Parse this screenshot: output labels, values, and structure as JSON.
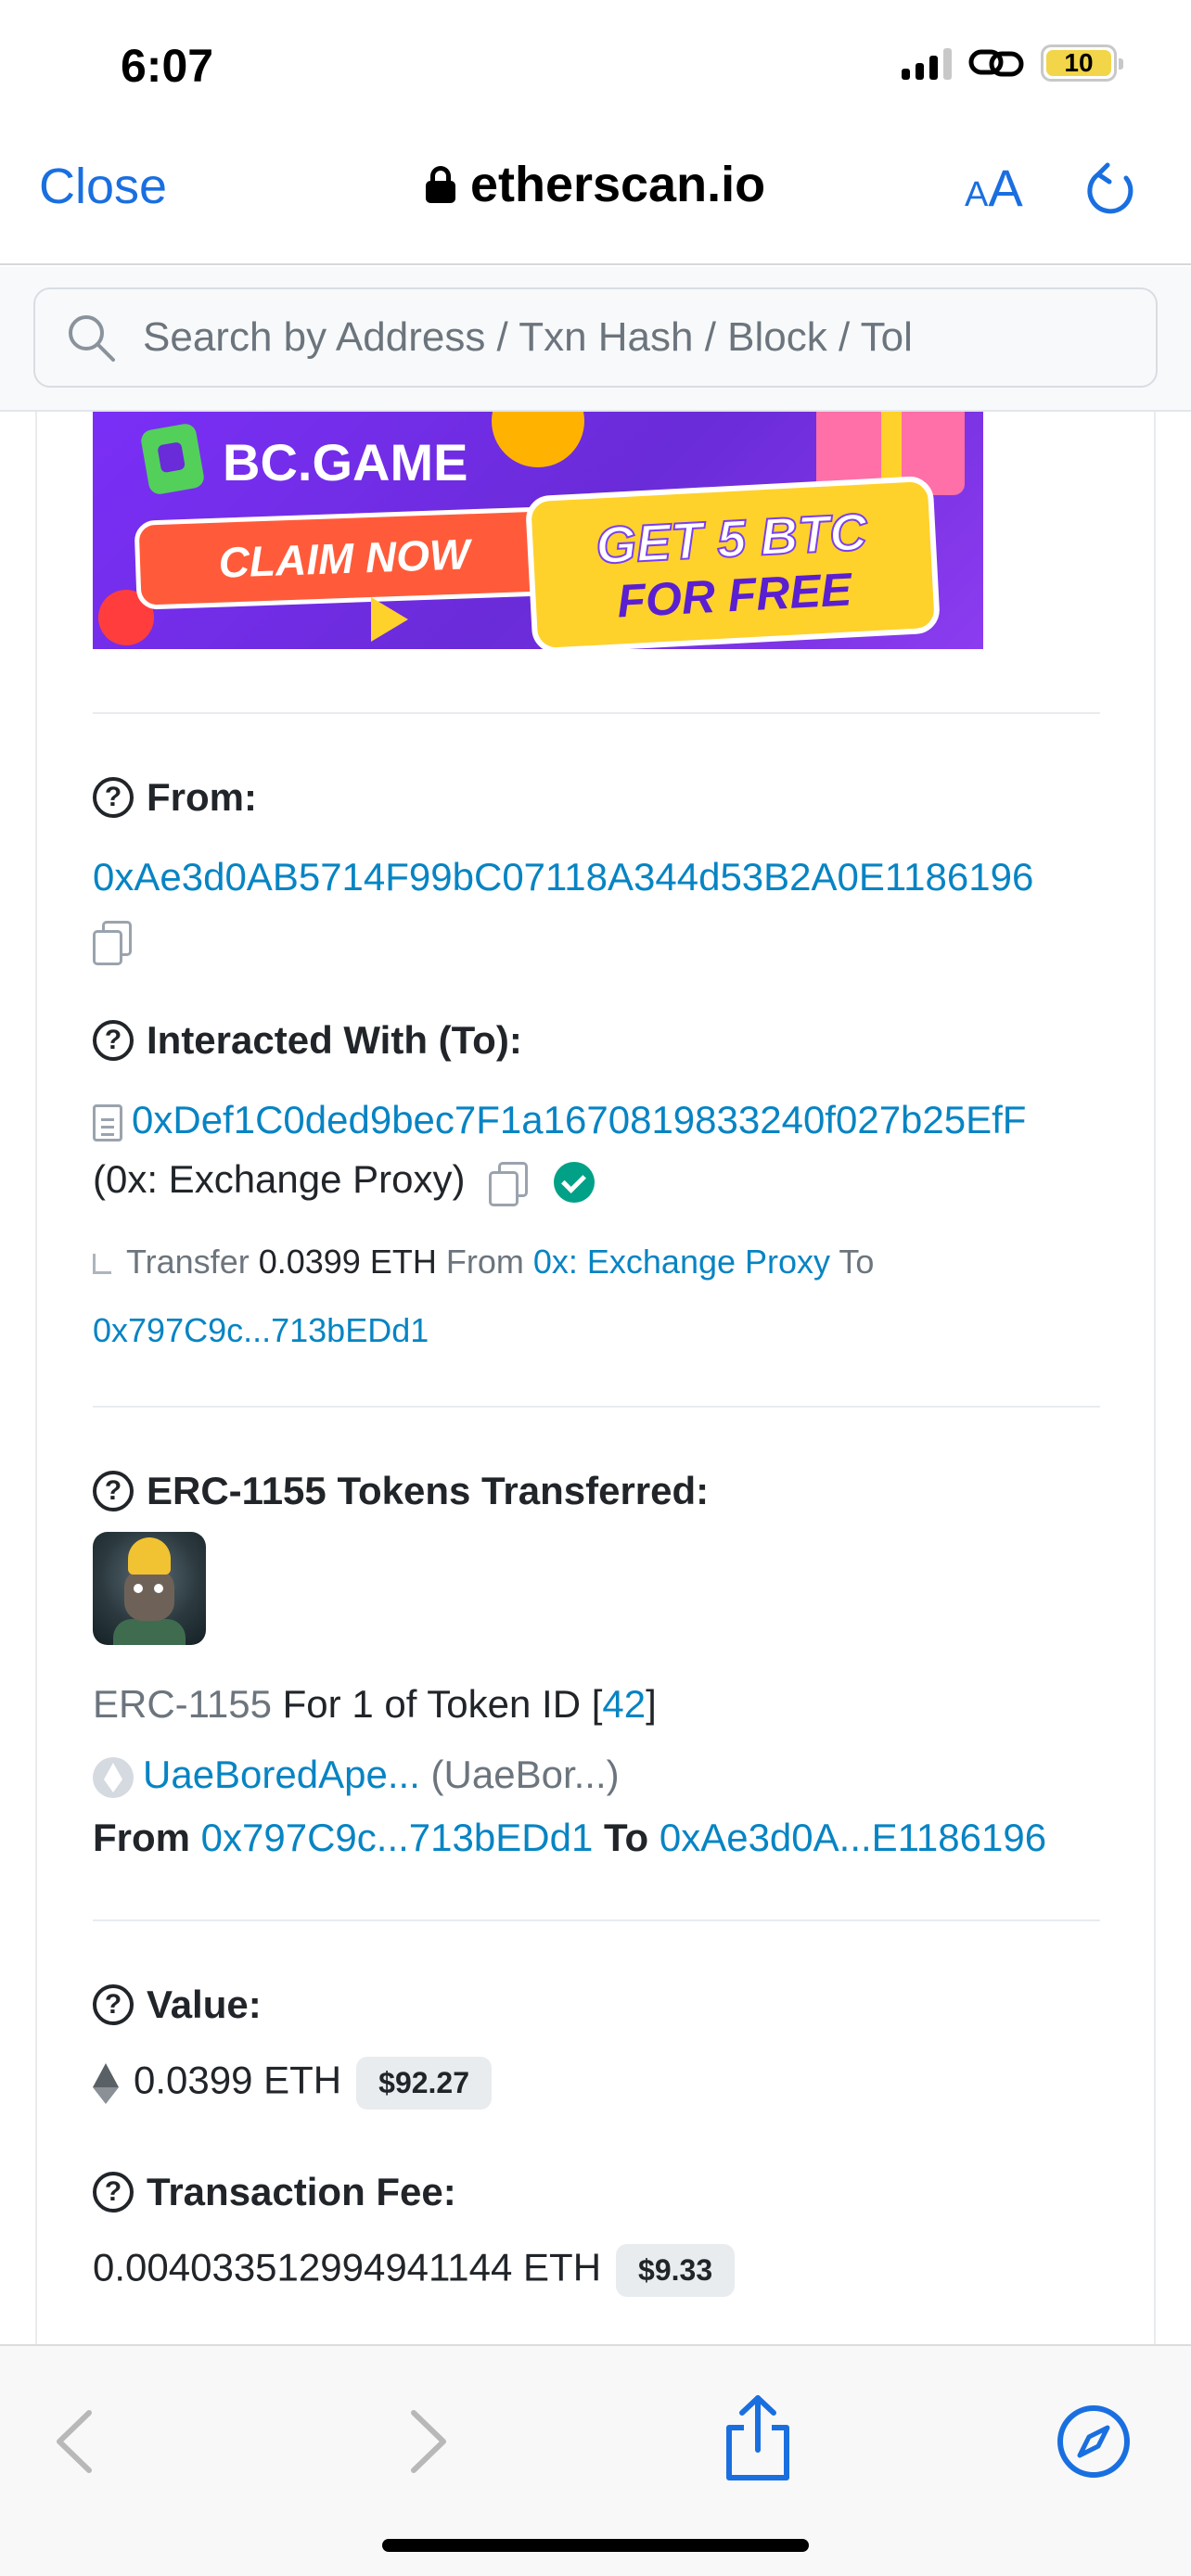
{
  "status_bar": {
    "time": "6:07",
    "battery": "10"
  },
  "browser": {
    "close_label": "Close",
    "url": "etherscan.io",
    "text_size_small": "A",
    "text_size_big": "A",
    "accent_color": "#1a6fe0"
  },
  "search": {
    "placeholder": "Search by Address / Txn Hash / Block / Tol"
  },
  "banner": {
    "brand": "BC.GAME",
    "claim_label": "CLAIM NOW",
    "promo_line1": "GET 5 BTC",
    "promo_line2": "FOR FREE"
  },
  "from": {
    "label": "From:",
    "address": "0xAe3d0AB5714F99bC07118A344d53B2A0E1186196"
  },
  "interacted": {
    "label": "Interacted With (To):",
    "address": "0xDef1C0ded9bec7F1a1670819833240f027b25EfF",
    "name": "(0x: Exchange Proxy)",
    "transfer": {
      "prefix": "Transfer",
      "amount": "0.0399 ETH",
      "from_word": "From",
      "from_name": "0x: Exchange Proxy",
      "to_word": "To",
      "to_address": "0x797C9c...713bEDd1"
    }
  },
  "tokens": {
    "label": "ERC-1155 Tokens Transferred:",
    "standard": "ERC-1155",
    "for_text": "For 1 of Token ID [",
    "token_id": "42",
    "close_bracket": "]",
    "token_name": "UaeBoredApe...",
    "token_symbol": "(UaeBor...)",
    "from_word": "From",
    "from_address": "0x797C9c...713bEDd1",
    "to_word": "To",
    "to_address": "0xAe3d0A...E1186196"
  },
  "value": {
    "label": "Value:",
    "amount": "0.0399 ETH",
    "usd": "$92.27"
  },
  "fee": {
    "label": "Transaction Fee:",
    "amount": "0.004033512994941144 ETH",
    "usd": "$9.33"
  },
  "colors": {
    "link": "#0784c3",
    "success": "#00a186"
  }
}
